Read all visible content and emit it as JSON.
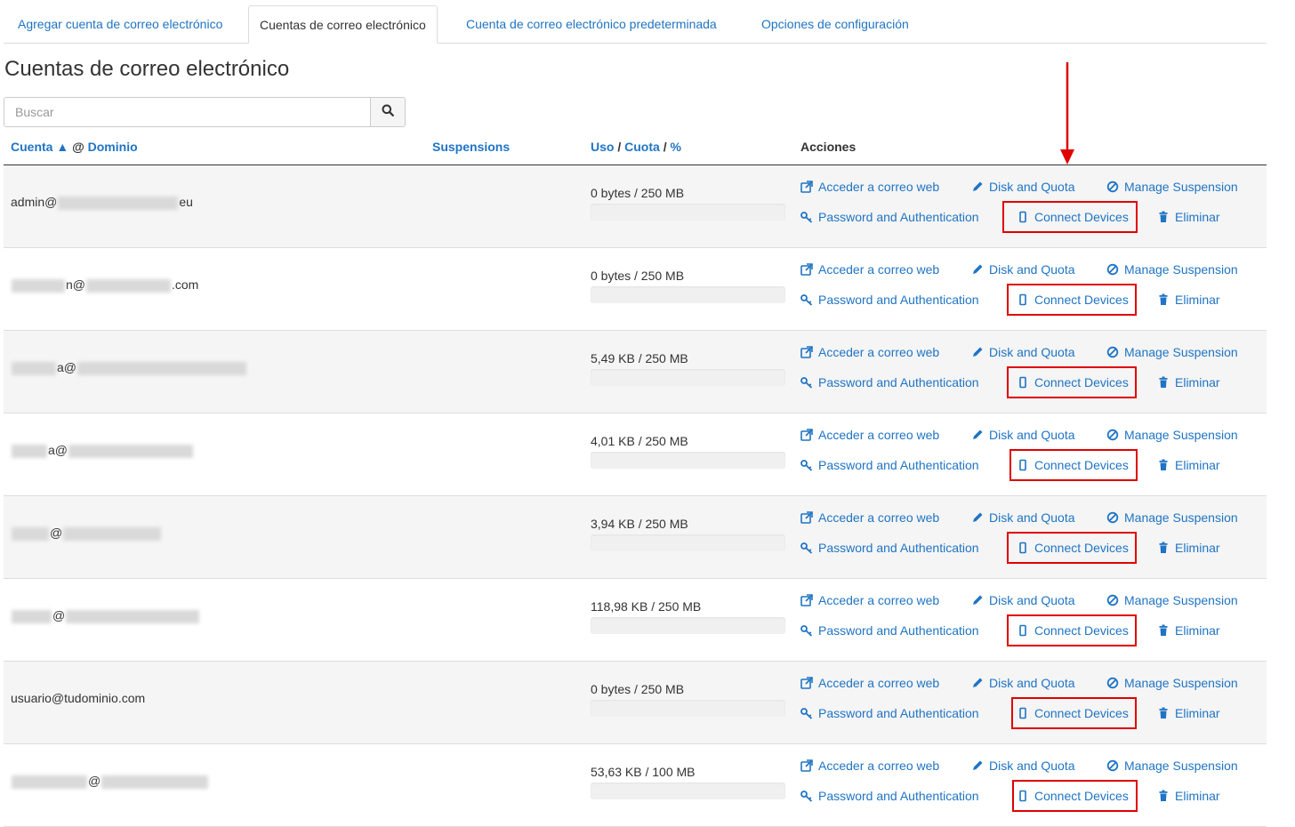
{
  "tabs": [
    {
      "label": "Agregar cuenta de correo electrónico"
    },
    {
      "label": "Cuentas de correo electrónico"
    },
    {
      "label": "Cuenta de correo electrónico predeterminada"
    },
    {
      "label": "Opciones de configuración"
    }
  ],
  "page_title": "Cuentas de correo electrónico",
  "search": {
    "placeholder": "Buscar",
    "icon": "search-icon"
  },
  "table": {
    "headers": {
      "account": "Cuenta",
      "sort_indicator": "▲",
      "at": "@",
      "domain": "Dominio",
      "suspensions": "Suspensions",
      "usage": "Uso",
      "slash1": "/",
      "quota": "Cuota",
      "slash2": "/",
      "percent": "%",
      "actions": "Acciones"
    },
    "action_labels": {
      "webmail": "Acceder a correo web",
      "disk": "Disk and Quota",
      "suspension": "Manage Suspension",
      "password": "Password and Authentication",
      "connect": "Connect Devices",
      "delete": "Eliminar"
    },
    "rows": [
      {
        "prefix": "admin@",
        "suffix": "eu",
        "usage": "0 bytes / 250 MB",
        "fill": 0
      },
      {
        "prefix": "n@",
        "suffix": ".com",
        "usage": "0 bytes / 250 MB",
        "fill": 0
      },
      {
        "prefix": "a@",
        "suffix": "",
        "usage": "5,49 KB / 250 MB",
        "fill": 0
      },
      {
        "prefix": "a@",
        "suffix": "",
        "usage": "4,01 KB / 250 MB",
        "fill": 0
      },
      {
        "prefix": "@",
        "suffix": "",
        "usage": "3,94 KB / 250 MB",
        "fill": 0
      },
      {
        "prefix": "@",
        "suffix": "",
        "usage": "118,98 KB / 250 MB",
        "fill": 0
      },
      {
        "prefix": "usuario@tudominio.com",
        "suffix": "",
        "usage": "0 bytes / 250 MB",
        "fill": 0
      },
      {
        "prefix": "@",
        "suffix": "",
        "usage": "53,63 KB / 100 MB",
        "fill": 0
      }
    ]
  },
  "colors": {
    "link": "#1f74c4",
    "highlight": "#e00000",
    "stripe": "#f5f5f5"
  }
}
